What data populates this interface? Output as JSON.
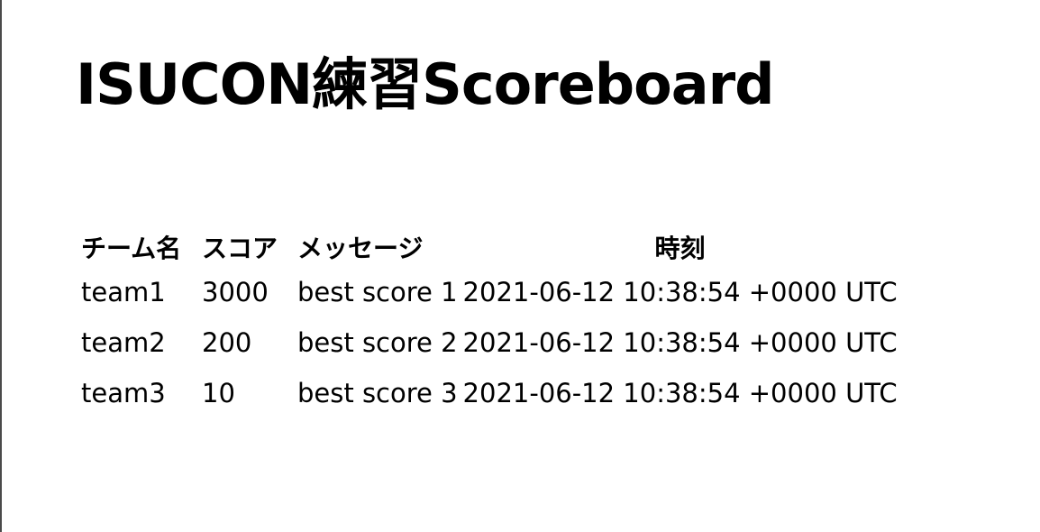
{
  "page": {
    "title": "ISUCON練習Scoreboard"
  },
  "table": {
    "headers": {
      "team": "チーム名",
      "score": "スコア",
      "message": "メッセージ",
      "time": "時刻"
    },
    "rows": [
      {
        "team": "team1",
        "score": "3000",
        "message": "best score 1",
        "time": "2021-06-12 10:38:54 +0000 UTC"
      },
      {
        "team": "team2",
        "score": "200",
        "message": "best score 2",
        "time": "2021-06-12 10:38:54 +0000 UTC"
      },
      {
        "team": "team3",
        "score": "10",
        "message": "best score 3",
        "time": "2021-06-12 10:38:54 +0000 UTC"
      }
    ]
  }
}
